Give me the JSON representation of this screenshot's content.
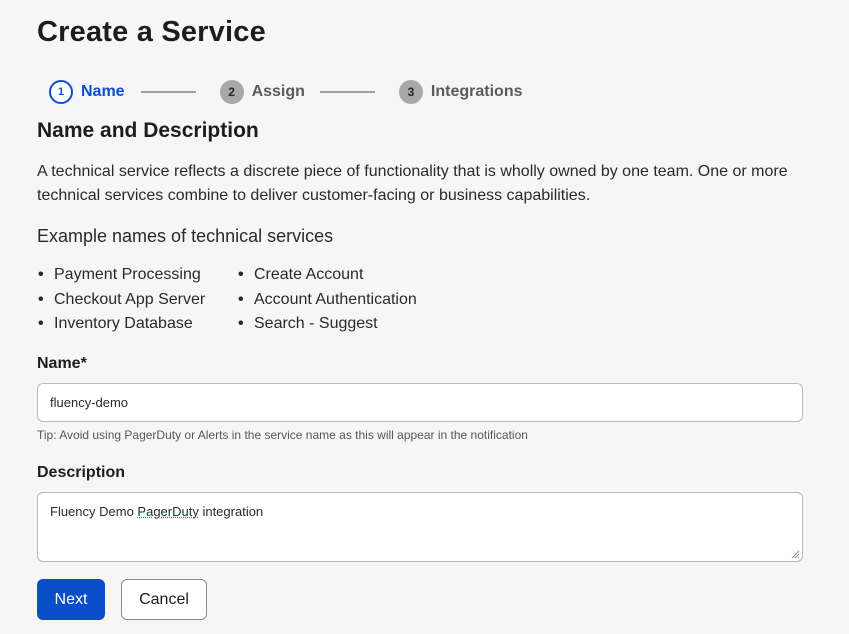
{
  "page": {
    "title": "Create a Service"
  },
  "stepper": {
    "steps": [
      {
        "number": "1",
        "label": "Name",
        "state": "active"
      },
      {
        "number": "2",
        "label": "Assign",
        "state": "upcoming"
      },
      {
        "number": "3",
        "label": "Integrations",
        "state": "upcoming"
      }
    ]
  },
  "section": {
    "title": "Name and Description",
    "description": "A technical service reflects a discrete piece of functionality that is wholly owned by one team. One or more technical services combine to deliver customer-facing or business capabilities.",
    "examples_title": "Example names of technical services",
    "examples_left": [
      "Payment Processing",
      "Checkout App Server",
      "Inventory Database"
    ],
    "examples_right": [
      "Create Account",
      "Account Authentication",
      "Search - Suggest"
    ]
  },
  "form": {
    "name_label": "Name*",
    "name_value": "fluency-demo",
    "name_tip": "Tip: Avoid using PagerDuty or Alerts in the service name as this will appear in the notification",
    "description_label": "Description",
    "description_value_before": "Fluency Demo ",
    "description_value_flagged": "PagerDuty",
    "description_value_after": " integration"
  },
  "actions": {
    "next_label": "Next",
    "cancel_label": "Cancel"
  },
  "colors": {
    "accent": "#0b4ed1",
    "background": "#f6f6f6",
    "inactive_step": "#a8a8a8"
  }
}
